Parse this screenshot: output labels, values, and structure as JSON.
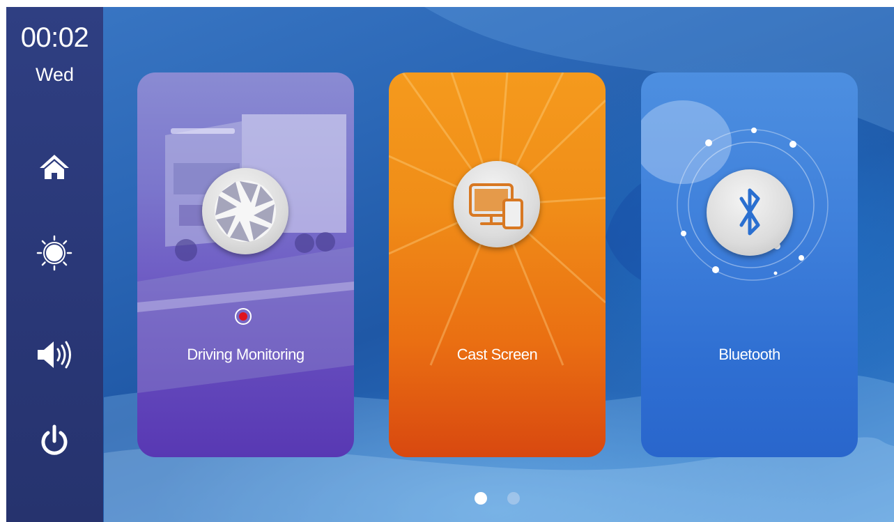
{
  "status": {
    "time": "00:02",
    "day": "Wed"
  },
  "sidebar": {
    "buttons": [
      {
        "name": "home-icon"
      },
      {
        "name": "brightness-icon"
      },
      {
        "name": "volume-icon"
      },
      {
        "name": "power-icon"
      }
    ]
  },
  "apps": [
    {
      "label": "Driving Monitoring",
      "icon": "camera-aperture-icon",
      "recording": true
    },
    {
      "label": "Cast Screen",
      "icon": "cast-screen-icon"
    },
    {
      "label": "Bluetooth",
      "icon": "bluetooth-icon"
    }
  ],
  "pagination": {
    "current_page": 1,
    "total_pages": 2
  },
  "colors": {
    "sidebar_bg": "#2a3878",
    "card_driving": "#6b55c2",
    "card_cast": "#f08d18",
    "card_bluetooth": "#3f80db",
    "record_red": "#e0141e",
    "background": "#2b67b6"
  }
}
